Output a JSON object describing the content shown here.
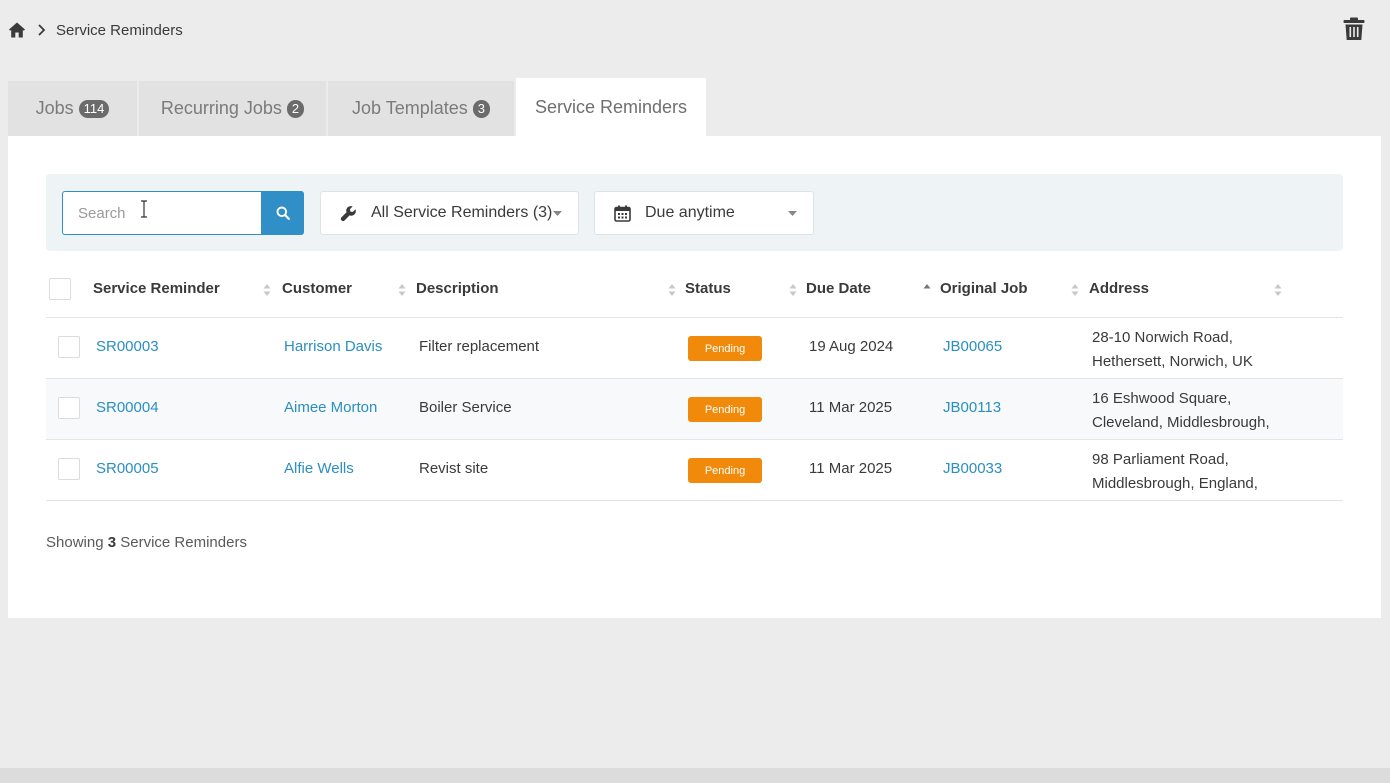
{
  "breadcrumb": {
    "current": "Service Reminders"
  },
  "tabs": [
    {
      "label": "Jobs",
      "badge": "114"
    },
    {
      "label": "Recurring Jobs",
      "badge": "2"
    },
    {
      "label": "Job Templates",
      "badge": "3"
    },
    {
      "label": "Service Reminders",
      "badge": ""
    }
  ],
  "filters": {
    "search_placeholder": "Search",
    "search_value": "",
    "reminder_filter": "All Service Reminders (3)",
    "due_filter": "Due anytime"
  },
  "table": {
    "columns": [
      "Service Reminder",
      "Customer",
      "Description",
      "Status",
      "Due Date",
      "Original Job",
      "Address"
    ],
    "rows": [
      {
        "id": "SR00003",
        "customer": "Harrison Davis",
        "description": "Filter replacement",
        "status": "Pending",
        "due": "19 Aug 2024",
        "job": "JB00065",
        "address1": "28-10 Norwich Road,",
        "address2": "Hethersett, Norwich, UK"
      },
      {
        "id": "SR00004",
        "customer": "Aimee Morton",
        "description": "Boiler Service",
        "status": "Pending",
        "due": "11 Mar 2025",
        "job": "JB00113",
        "address1": "16 Eshwood Square,",
        "address2": "Cleveland, Middlesbrough,"
      },
      {
        "id": "SR00005",
        "customer": "Alfie Wells",
        "description": "Revist site",
        "status": "Pending",
        "due": "11 Mar 2025",
        "job": "JB00033",
        "address1": "98 Parliament Road,",
        "address2": "Middlesbrough, England,"
      }
    ]
  },
  "footer": {
    "prefix": "Showing",
    "count": "3",
    "suffix": "Service Reminders"
  },
  "colors": {
    "accent": "#2f8fc6",
    "link": "#2a8fc2",
    "status_pending": "#f18a0a"
  },
  "icons": [
    "home-icon",
    "chevron-right-icon",
    "trash-icon",
    "search-icon",
    "wrench-icon",
    "calendar-icon",
    "caret-down-icon",
    "sort-icon"
  ]
}
